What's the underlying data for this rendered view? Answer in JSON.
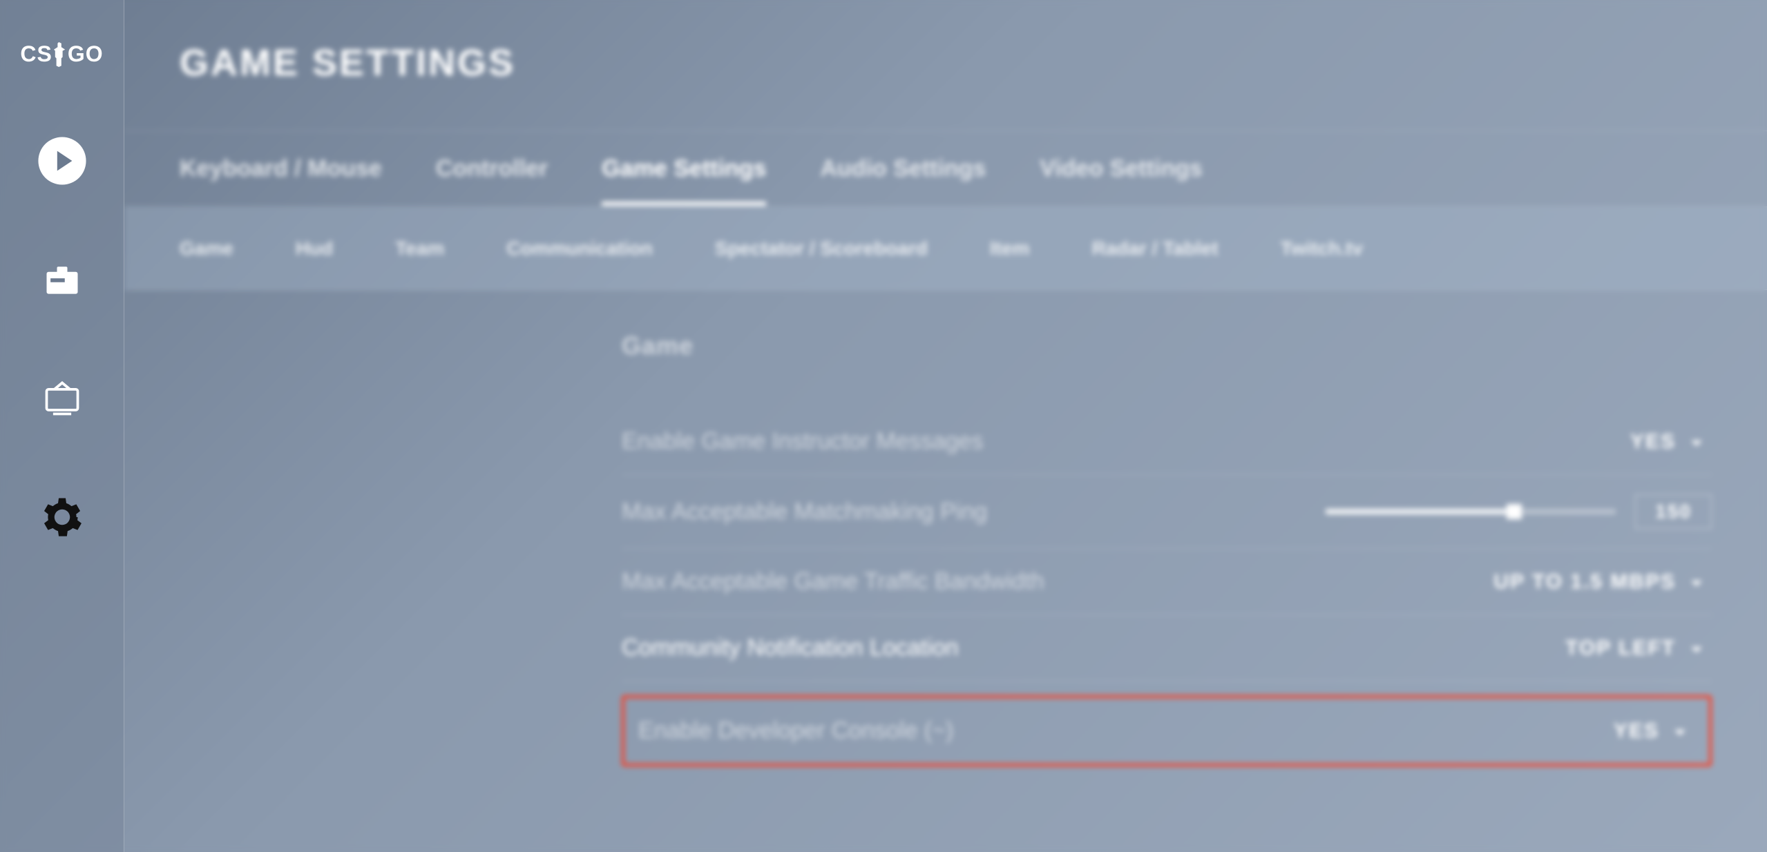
{
  "logo": {
    "left": "CS",
    "right": "GO"
  },
  "page_title": "GAME SETTINGS",
  "tabs": {
    "primary": [
      "Keyboard / Mouse",
      "Controller",
      "Game Settings",
      "Audio Settings",
      "Video Settings"
    ],
    "primary_active_index": 2,
    "secondary": [
      "Game",
      "Hud",
      "Team",
      "Communication",
      "Spectator / Scoreboard",
      "Item",
      "Radar / Tablet",
      "Twitch.tv"
    ]
  },
  "section": {
    "title": "Game"
  },
  "settings": {
    "instructor": {
      "label": "Enable Game Instructor Messages",
      "value": "YES"
    },
    "ping": {
      "label": "Max Acceptable Matchmaking Ping",
      "value": "150",
      "slider_percent": 65
    },
    "bandwidth": {
      "label": "Max Acceptable Game Traffic Bandwidth",
      "value": "UP TO 1.5 MBPS"
    },
    "notify": {
      "label": "Community Notification Location",
      "value": "TOP LEFT"
    },
    "devconsole": {
      "label": "Enable Developer Console (~)",
      "value": "YES"
    }
  }
}
